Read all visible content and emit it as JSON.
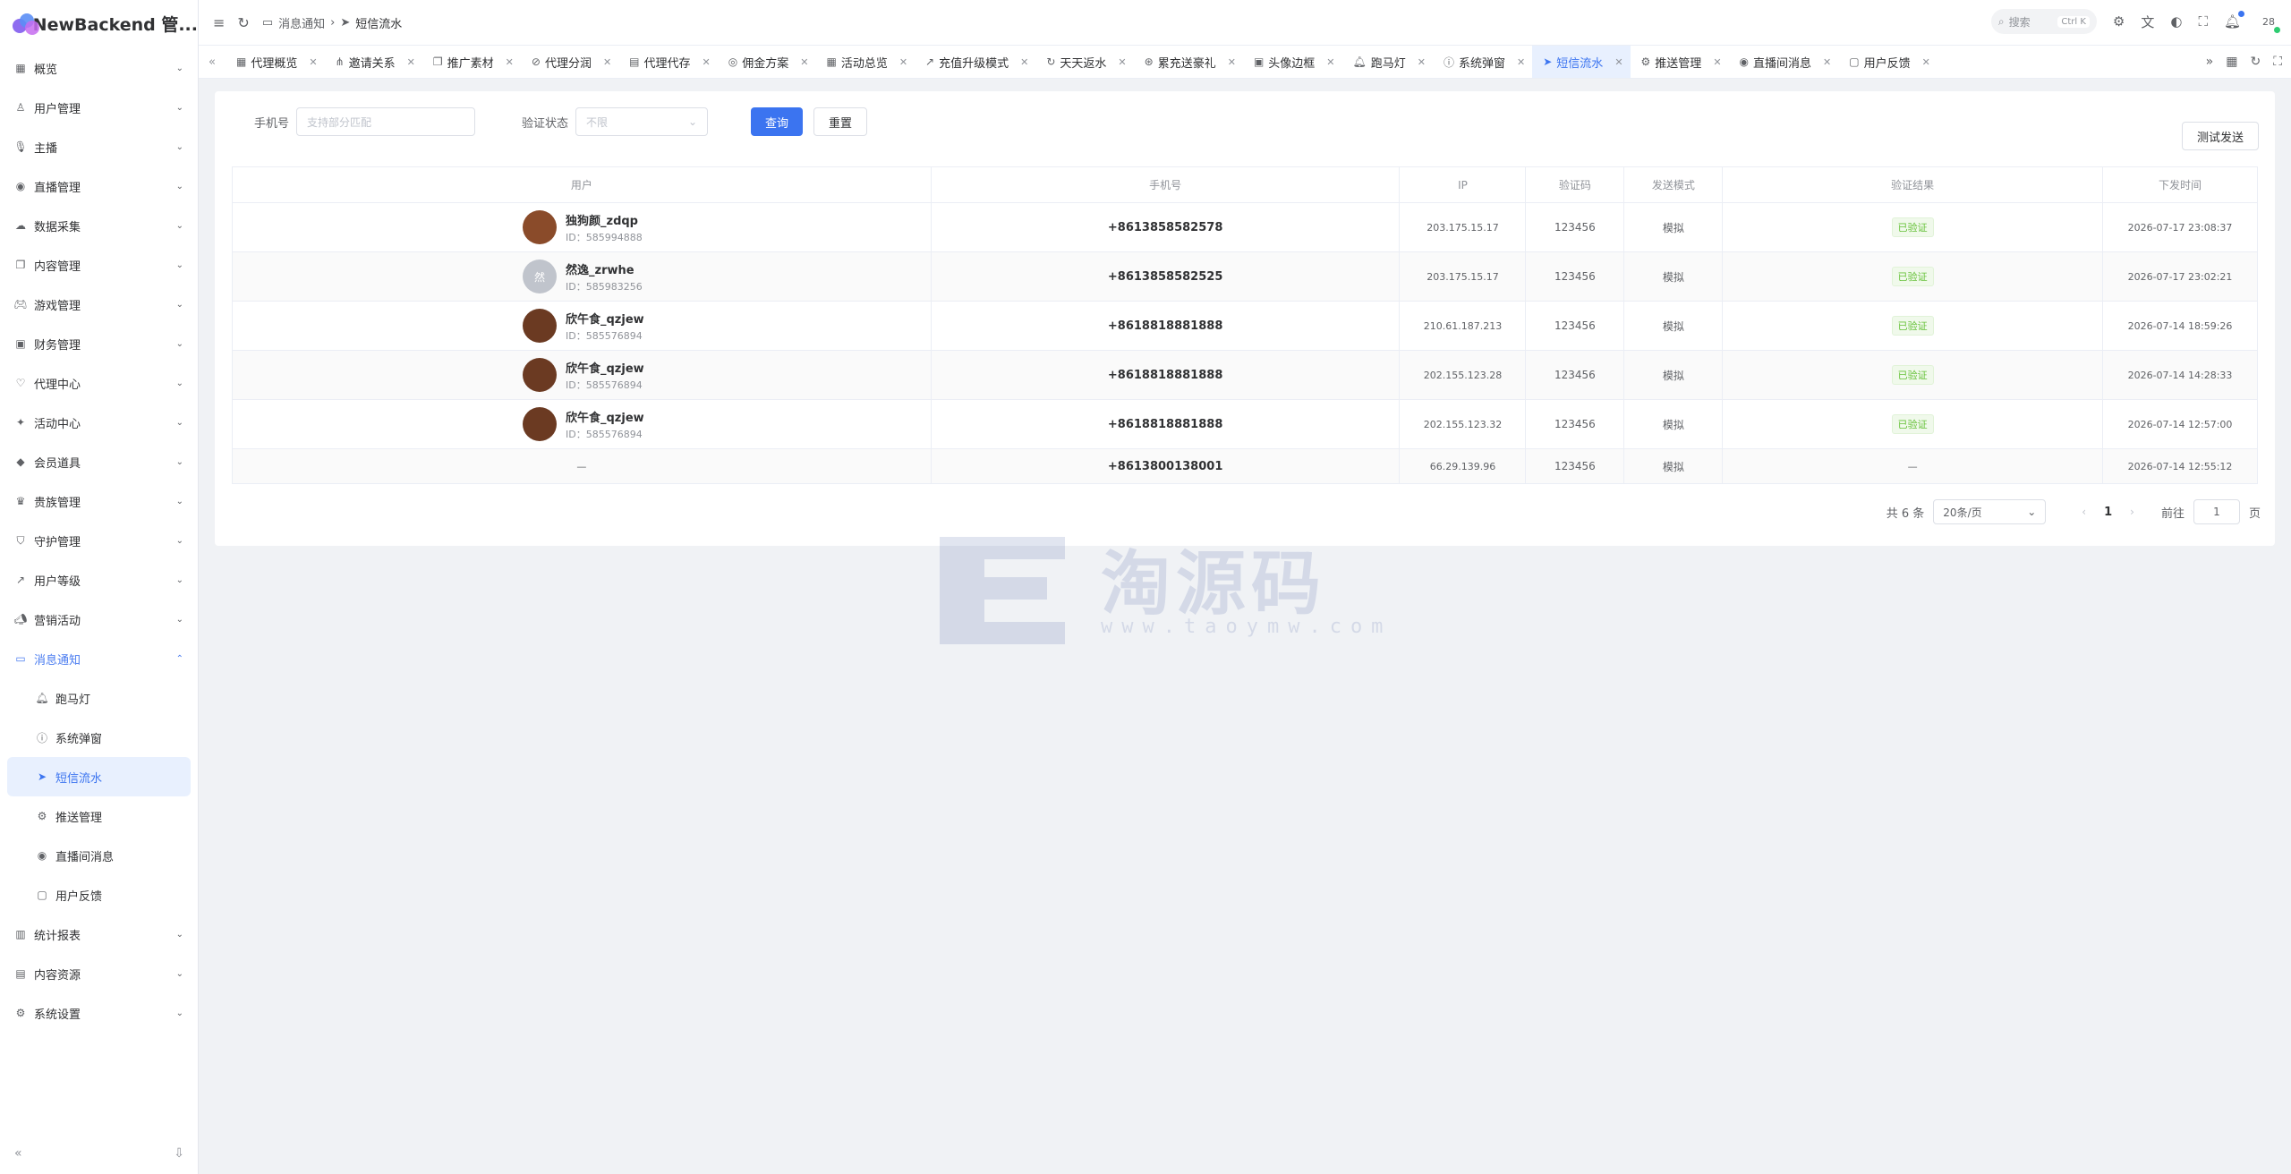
{
  "app": {
    "name": "NewBackend 管..."
  },
  "sidebar": {
    "items": [
      {
        "label": "概览",
        "icon": "grid-icon",
        "chev": "⌄"
      },
      {
        "label": "用户管理",
        "icon": "user-icon",
        "chev": "⌄"
      },
      {
        "label": "主播",
        "icon": "mic-icon",
        "chev": "⌄"
      },
      {
        "label": "直播管理",
        "icon": "broadcast-icon",
        "chev": "⌄"
      },
      {
        "label": "数据采集",
        "icon": "cloud-icon",
        "chev": "⌄"
      },
      {
        "label": "内容管理",
        "icon": "copy-icon",
        "chev": "⌄"
      },
      {
        "label": "游戏管理",
        "icon": "gamepad-icon",
        "chev": "⌄"
      },
      {
        "label": "财务管理",
        "icon": "wallet-icon",
        "chev": "⌄"
      },
      {
        "label": "代理中心",
        "icon": "handshake-icon",
        "chev": "⌄"
      },
      {
        "label": "活动中心",
        "icon": "sparkle-icon",
        "chev": "⌄"
      },
      {
        "label": "会员道具",
        "icon": "gem-icon",
        "chev": "⌄"
      },
      {
        "label": "贵族管理",
        "icon": "crown-icon",
        "chev": "⌄"
      },
      {
        "label": "守护管理",
        "icon": "shield-icon",
        "chev": "⌄"
      },
      {
        "label": "用户等级",
        "icon": "trend-icon",
        "chev": "⌄"
      },
      {
        "label": "营销活动",
        "icon": "megaphone-icon",
        "chev": "⌄"
      },
      {
        "label": "消息通知",
        "icon": "message-icon",
        "chev": "⌃"
      }
    ],
    "subitems": [
      {
        "label": "跑马灯",
        "icon": "bell-icon"
      },
      {
        "label": "系统弹窗",
        "icon": "info-icon"
      },
      {
        "label": "短信流水",
        "icon": "send-icon"
      },
      {
        "label": "推送管理",
        "icon": "gear-icon"
      },
      {
        "label": "直播间消息",
        "icon": "broadcast-icon"
      },
      {
        "label": "用户反馈",
        "icon": "feedback-icon"
      }
    ],
    "items2": [
      {
        "label": "统计报表",
        "icon": "chart-icon",
        "chev": "⌄"
      },
      {
        "label": "内容资源",
        "icon": "book-icon",
        "chev": "⌄"
      },
      {
        "label": "系统设置",
        "icon": "gear-icon",
        "chev": "⌄"
      }
    ]
  },
  "topbar": {
    "breadcrumb": [
      "消息通知",
      "短信流水"
    ],
    "search_placeholder": "搜索",
    "search_kbd": "Ctrl K",
    "avatar_text": "28"
  },
  "tabs": [
    {
      "label": "代理概览"
    },
    {
      "label": "邀请关系"
    },
    {
      "label": "推广素材"
    },
    {
      "label": "代理分润"
    },
    {
      "label": "代理代存"
    },
    {
      "label": "佣金方案"
    },
    {
      "label": "活动总览"
    },
    {
      "label": "充值升级模式"
    },
    {
      "label": "天天返水"
    },
    {
      "label": "累充送豪礼"
    },
    {
      "label": "头像边框"
    },
    {
      "label": "跑马灯"
    },
    {
      "label": "系统弹窗"
    },
    {
      "label": "短信流水",
      "active": true
    },
    {
      "label": "推送管理"
    },
    {
      "label": "直播间消息"
    },
    {
      "label": "用户反馈"
    }
  ],
  "filters": {
    "phone_label": "手机号",
    "phone_placeholder": "支持部分匹配",
    "status_label": "验证状态",
    "status_value": "不限",
    "query_label": "查询",
    "reset_label": "重置",
    "test_label": "测试发送"
  },
  "table": {
    "headers": [
      "用户",
      "手机号",
      "IP",
      "验证码",
      "发送模式",
      "验证结果",
      "下发时间"
    ],
    "rows": [
      {
        "name": "独狗颜_zdqp",
        "uid": "ID：585994888",
        "phone": "+8613858582578",
        "ip": "203.175.15.17",
        "code": "123456",
        "mode": "模拟",
        "result": "已验证",
        "time": "2026-07-17 23:08:37"
      },
      {
        "name": "然逸_zrwhe",
        "uid": "ID：585983256",
        "phone": "+8613858582525",
        "ip": "203.175.15.17",
        "code": "123456",
        "mode": "模拟",
        "result": "已验证",
        "time": "2026-07-17 23:02:21"
      },
      {
        "name": "欣午食_qzjew",
        "uid": "ID：585576894",
        "phone": "+8618818881888",
        "ip": "210.61.187.213",
        "code": "123456",
        "mode": "模拟",
        "result": "已验证",
        "time": "2026-07-14 18:59:26"
      },
      {
        "name": "欣午食_qzjew",
        "uid": "ID：585576894",
        "phone": "+8618818881888",
        "ip": "202.155.123.28",
        "code": "123456",
        "mode": "模拟",
        "result": "已验证",
        "time": "2026-07-14 14:28:33"
      },
      {
        "name": "欣午食_qzjew",
        "uid": "ID：585576894",
        "phone": "+8618818881888",
        "ip": "202.155.123.32",
        "code": "123456",
        "mode": "模拟",
        "result": "已验证",
        "time": "2026-07-14 12:57:00"
      },
      {
        "name": "—",
        "uid": "",
        "phone": "+8613800138001",
        "ip": "66.29.139.96",
        "code": "123456",
        "mode": "模拟",
        "result": "—",
        "time": "2026-07-14 12:55:12"
      }
    ]
  },
  "pagination": {
    "total": "共 6 条",
    "page_size": "20条/页",
    "current": "1",
    "goto_label": "前往",
    "goto_value": "1",
    "page_suffix": "页"
  },
  "watermark": {
    "cn": "淘源码",
    "en": "www.taoymw.com"
  },
  "colors": {
    "accent": "#3b74f0",
    "success": "#67c23a"
  }
}
